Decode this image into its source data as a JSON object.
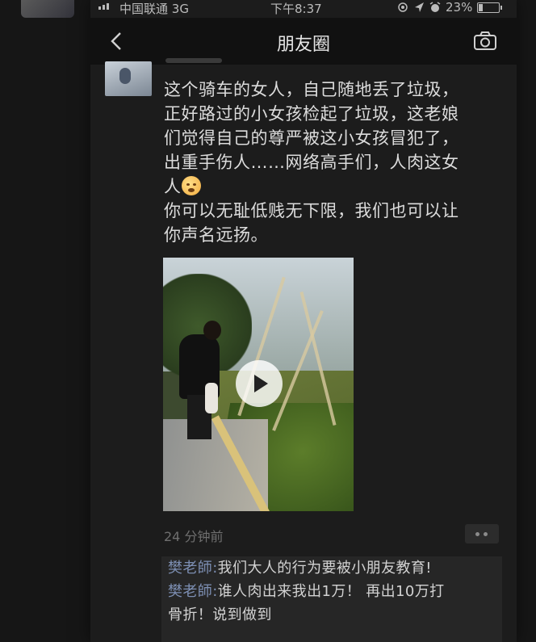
{
  "status_bar": {
    "carrier": "中国联通",
    "network": "3G",
    "time": "下午8:37",
    "battery": "23%",
    "battery_level": 0.23
  },
  "nav": {
    "title": "朋友圈"
  },
  "post": {
    "lines": [
      "这个骑车的女人，自己随地丢了垃圾，",
      "正好路过的小女孩检起了垃圾，这老娘",
      "们觉得自己的尊严被这小女孩冒犯了，",
      "出重手伤人……网络高手们，人肉这女",
      "人",
      "你可以无耻低贱无下限，我们也可以让",
      "你声名远扬。"
    ],
    "emoji": "weary-face-emoji",
    "time_ago": "24 分钟前"
  },
  "comments": [
    {
      "name": "樊老師:",
      "text": "我们大人的行为要被小朋友教育!"
    },
    {
      "name": "樊老師:",
      "text": "谁人肉出来我出1万！ 再出10万打"
    },
    {
      "name": "",
      "text": "骨折！说到做到"
    }
  ],
  "colors": {
    "background": "#161616",
    "navbar": "#111111",
    "comment_name": "#7d8fb3",
    "comment_bg": "#262626"
  }
}
